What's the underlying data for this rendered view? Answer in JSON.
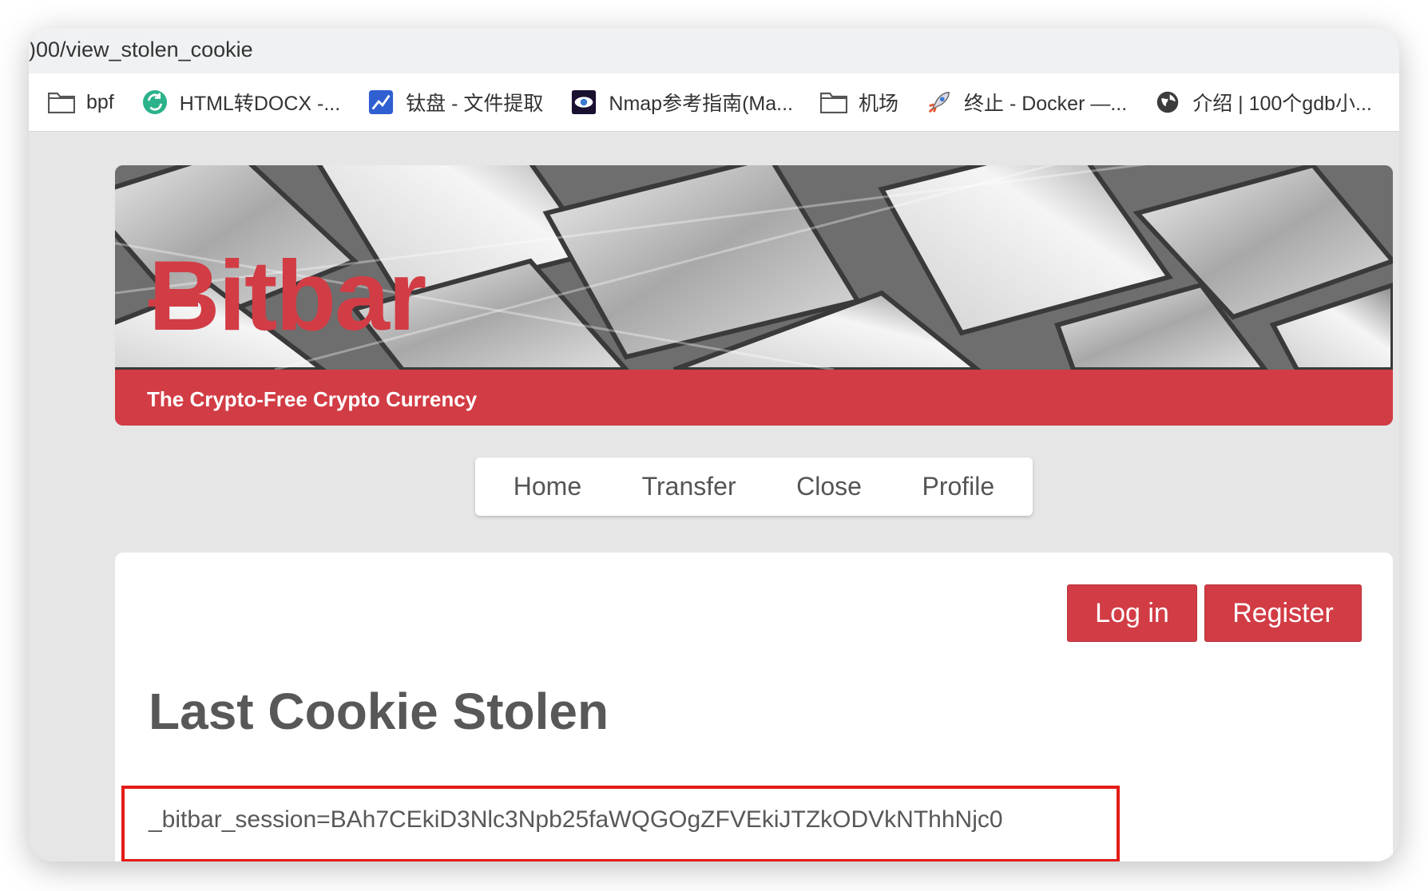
{
  "browser": {
    "url": ")00/view_stolen_cookie",
    "bookmarks": [
      {
        "label": "bpf",
        "icon": "folder-icon"
      },
      {
        "label": "HTML转DOCX -...",
        "icon": "convert-icon"
      },
      {
        "label": "钛盘 - 文件提取",
        "icon": "tiapan-icon"
      },
      {
        "label": "Nmap参考指南(Ma...",
        "icon": "eye-icon"
      },
      {
        "label": "机场",
        "icon": "folder-icon"
      },
      {
        "label": "终止 - Docker —...",
        "icon": "rocket-icon"
      },
      {
        "label": "介绍 | 100个gdb小...",
        "icon": "globe-icon"
      }
    ]
  },
  "banner": {
    "brand": "Bitbar",
    "tagline": "The Crypto-Free Crypto Currency"
  },
  "nav": {
    "items": [
      "Home",
      "Transfer",
      "Close",
      "Profile"
    ]
  },
  "auth": {
    "login": "Log in",
    "register": "Register"
  },
  "main": {
    "heading": "Last Cookie Stolen",
    "cookie": "_bitbar_session=BAh7CEkiD3Nlc3Npb25faWQGOgZFVEkiJTZkODVkNThhNjc0"
  },
  "colors": {
    "accent": "#d23c45",
    "highlight_border": "#e41b17",
    "page_bg": "#e6e6e6"
  }
}
